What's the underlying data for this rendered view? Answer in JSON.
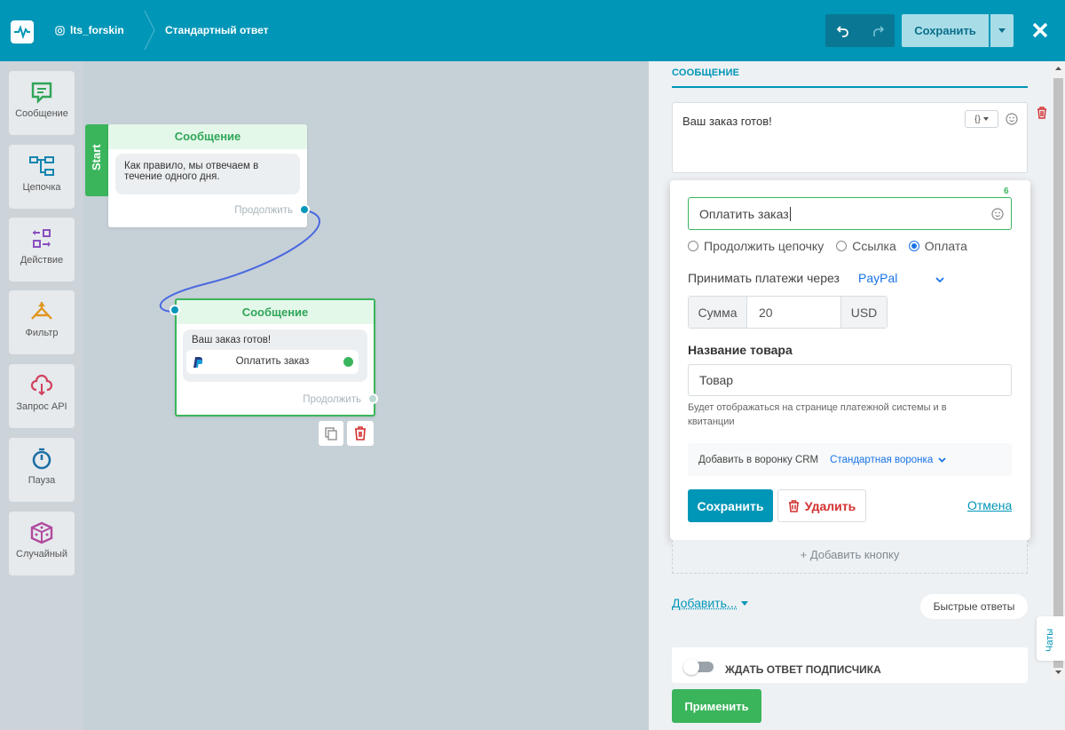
{
  "header": {
    "account": "lts_forskin",
    "title": "Стандартный ответ",
    "save_label": "Сохранить"
  },
  "palette": [
    {
      "label": "Сообщение"
    },
    {
      "label": "Цепочка"
    },
    {
      "label": "Действие"
    },
    {
      "label": "Фильтр"
    },
    {
      "label": "Запрос API"
    },
    {
      "label": "Пауза"
    },
    {
      "label": "Случайный"
    }
  ],
  "canvas": {
    "start_label": "Start",
    "node1": {
      "title": "Сообщение",
      "text": "Как правило, мы отвечаем в течение одного дня.",
      "continue": "Продолжить"
    },
    "node2": {
      "title": "Сообщение",
      "text": "Ваш заказ готов!",
      "button": "Оплатить заказ",
      "continue": "Продолжить"
    }
  },
  "panel": {
    "section_title": "СООБЩЕНИЕ",
    "message_text": "Ваш заказ готов!",
    "editor": {
      "char_count": "6",
      "button_text": "Оплатить заказ",
      "radio_options": [
        "Продолжить цепочку",
        "Ссылка",
        "Оплата"
      ],
      "radio_selected": "Оплата",
      "payment_label": "Принимать платежи через",
      "payment_provider": "PayPal",
      "sum_label": "Сумма",
      "sum_value": "20",
      "currency": "USD",
      "product_label": "Название товара",
      "product_value": "Товар",
      "product_hint": "Будет отображаться на странице платежной системы и в квитанции",
      "crm_label": "Добавить в воронку CRM",
      "crm_value": "Стандартная воронка",
      "save": "Сохранить",
      "delete": "Удалить",
      "cancel": "Отмена"
    },
    "add_button": "+ Добавить кнопку",
    "add_menu": "Добавить...",
    "quick_replies": "Быстрые ответы",
    "wait_reply": "ЖДАТЬ ОТВЕТ ПОДПИСЧИКА",
    "apply": "Применить",
    "chats_tab": "Чаты"
  },
  "colors": {
    "accent": "#0096b7",
    "green": "#3bb55c",
    "danger": "#d32f2f"
  }
}
